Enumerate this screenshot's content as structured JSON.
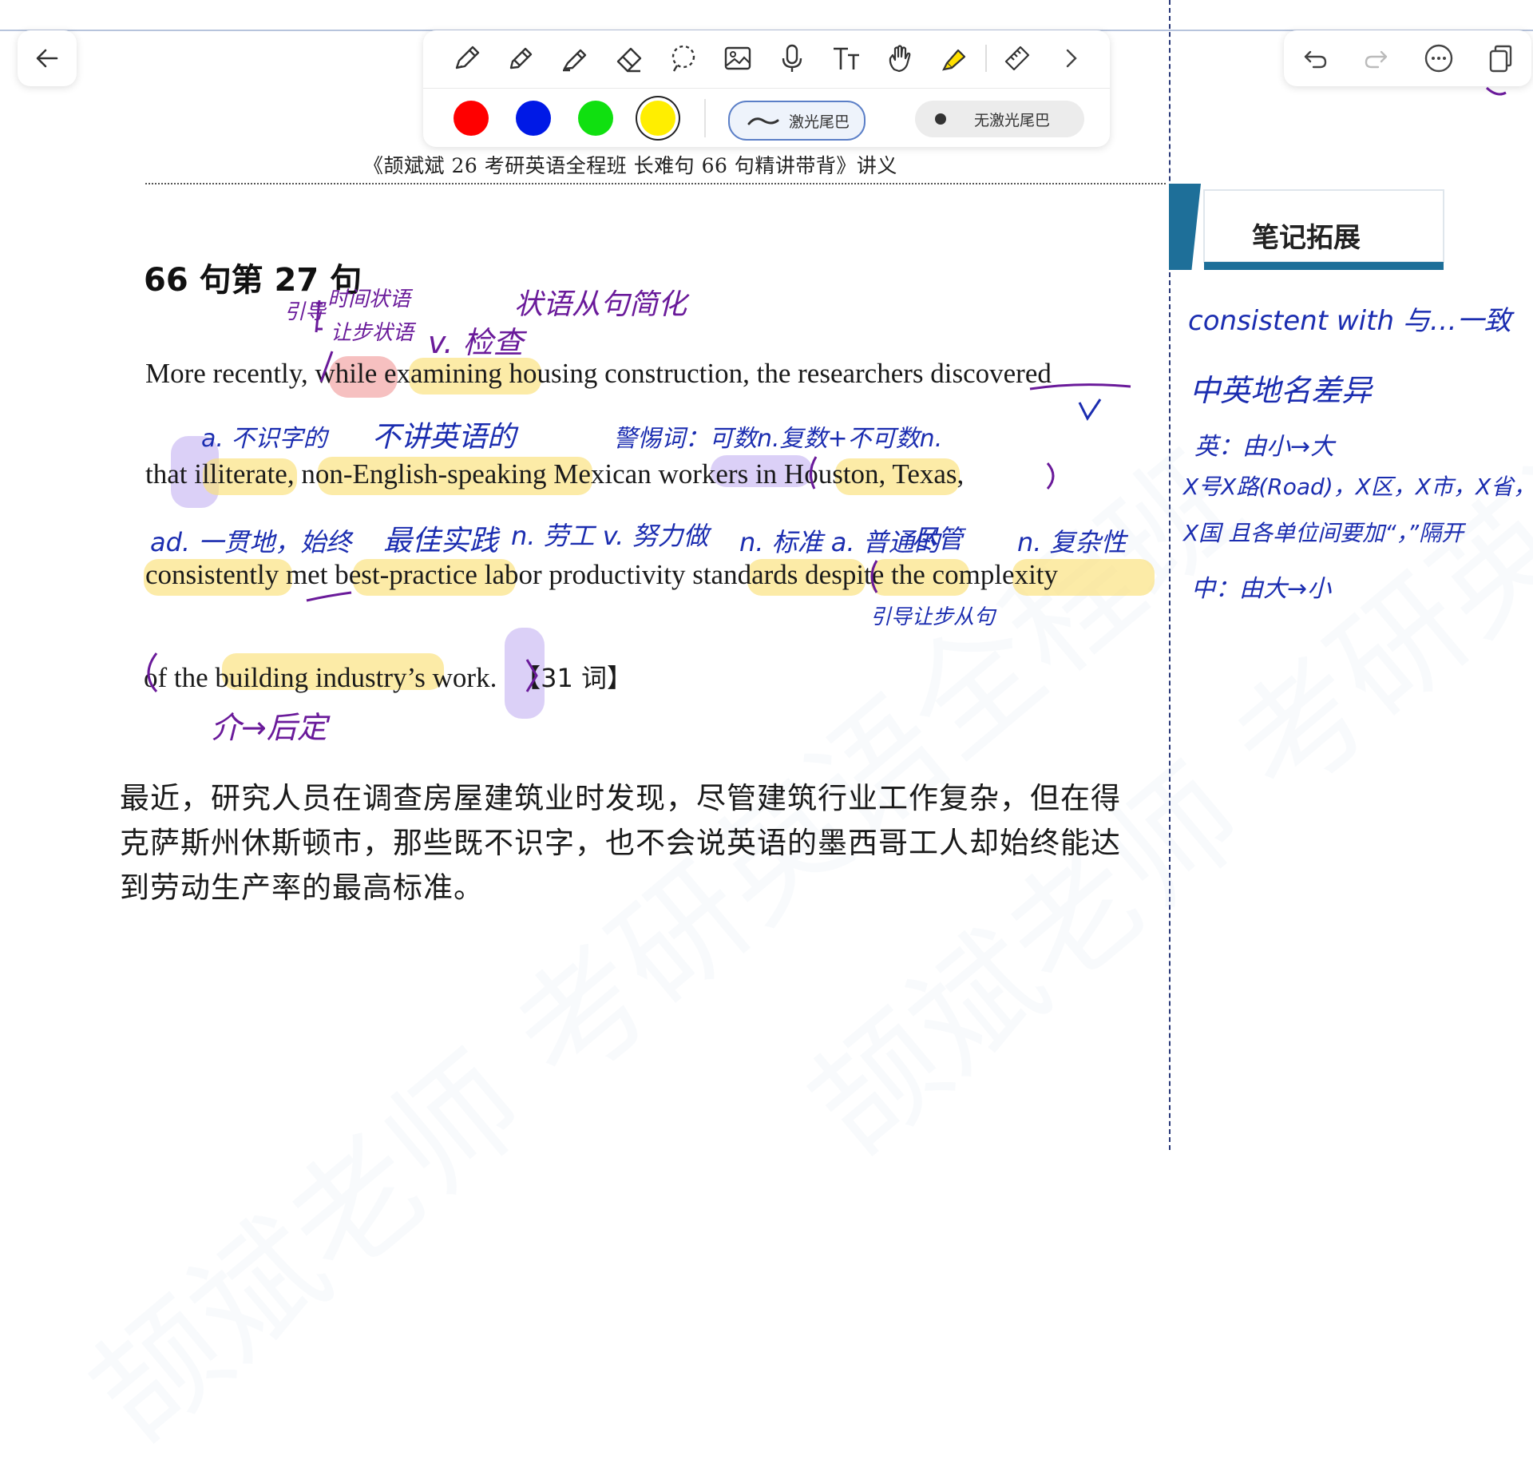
{
  "toolbar": {
    "tools": [
      "pen-icon",
      "pencil-icon",
      "marker-icon",
      "eraser-icon",
      "lasso-icon",
      "image-icon",
      "microphone-icon",
      "text-icon",
      "hand-icon",
      "highlighter-icon",
      "ruler-icon",
      "chevron-right-icon"
    ],
    "colors": [
      "#ff0000",
      "#0019e6",
      "#10e010",
      "#ffee00"
    ],
    "laser_trail_label": "激光尾巴",
    "no_laser_trail_label": "无激光尾巴"
  },
  "right_tools": [
    "undo-icon",
    "redo-icon",
    "more-icon",
    "pages-icon"
  ],
  "document": {
    "title": "《颉斌斌 26 考研英语全程班 长难句 66 句精讲带背》讲义",
    "heading": "66 句第 27 句",
    "line1_a": "More recently, ",
    "line1_b": "while",
    "line1_c": " examining housing construction, the researchers discovered",
    "line2": "that illiterate, non-English-speaking Mexican workers in Houston, Texas,",
    "line3": "consistently met best-practice labor productivity standards despite the complexity",
    "line4": "of the building industry’s work.",
    "word_count": "【31 词】",
    "translation": "最近，研究人员在调查房屋建筑业时发现，尽管建筑行业工作复杂，但在得克萨斯州休斯顿市，那些既不识字，也不会说英语的墨西哥工人却始终能达到劳动生产率的最高标准。"
  },
  "sidebar": {
    "title": "笔记拓展",
    "notes": [
      "consistent with 与…一致",
      "中英地名差异",
      "英：由小→大",
      "X号X路(Road)，X区，X市，X省，",
      "X国 且各单位间要加“，”隔开",
      "中：由大→小"
    ]
  },
  "annotations": {
    "a1": "引导",
    "a2": "时间状语",
    "a3": "让步状语",
    "a4": "v. 检查",
    "a5": "状语从句简化",
    "a6": "a. 不识字的",
    "a7": "不讲英语的",
    "a8": "警惕词：可数n.复数+不可数n.",
    "a9": "ad. 一贯地，始终",
    "a10": "最佳实践",
    "a11": "n. 劳工 v. 努力做",
    "a12": "n. 标准 a. 普通的",
    "a13": "尽管",
    "a14": "n. 复杂性",
    "a15": "引导让步从句",
    "a16": "介→后定"
  },
  "watermark": "颉斌老师 考研英语全程班"
}
